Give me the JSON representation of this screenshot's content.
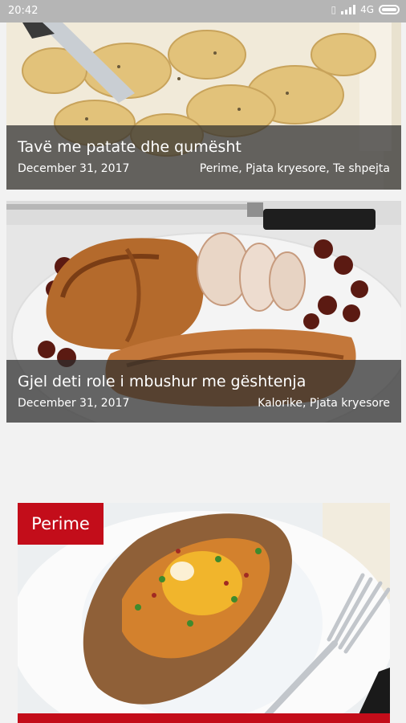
{
  "status_bar": {
    "time": "20:42",
    "network": "4G",
    "icons": [
      "vibrate-icon",
      "signal-icon",
      "battery-icon"
    ]
  },
  "posts": [
    {
      "title": "Tavë me patate dhe qumësht",
      "date": "December 31, 2017",
      "categories": "Perime, Pjata kryesore, Te shpejta"
    },
    {
      "title": "Gjel deti role i mbushur me gështenja",
      "date": "December 31, 2017",
      "categories": "Kalorike, Pjata kryesore"
    }
  ],
  "featured": {
    "category_badge": "Perime",
    "accent_color": "#c30d1a"
  }
}
